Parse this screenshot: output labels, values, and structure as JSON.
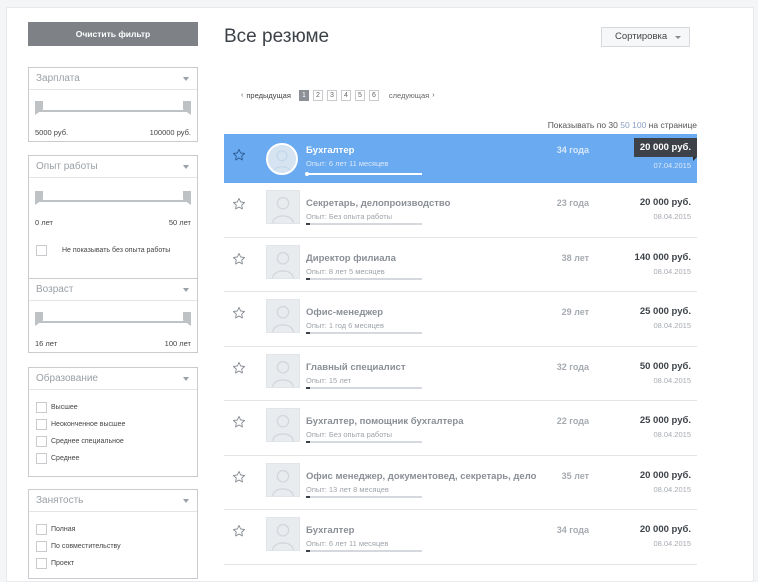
{
  "sidebar": {
    "clear_filter_label": "Очистить фильтр",
    "salary": {
      "title": "Зарплата",
      "min_label": "5000 руб.",
      "max_label": "100000 руб."
    },
    "experience": {
      "title": "Опыт работы",
      "min_label": "0 лет",
      "max_label": "50 лет",
      "no_exp_label": "Не показывать без опыта работы"
    },
    "age": {
      "title": "Возраст",
      "min_label": "16 лет",
      "max_label": "100 лет"
    },
    "education": {
      "title": "Образование",
      "items": [
        "Высшее",
        "Неоконченное высшее",
        "Среднее специальное",
        "Среднее"
      ]
    },
    "employment": {
      "title": "Занятость",
      "items": [
        "Полная",
        "По совместительству",
        "Проект"
      ]
    }
  },
  "main": {
    "title": "Все резюме",
    "sort_label": "Сортировка",
    "pager": {
      "prev": "предыдущая",
      "next": "следующая",
      "pages": [
        "1",
        "2",
        "3",
        "4",
        "5",
        "6"
      ],
      "active": "1"
    },
    "per_page": {
      "prefix": "Показывать по",
      "options": [
        "30",
        "50",
        "100"
      ],
      "suffix": "на странице"
    }
  },
  "resumes": [
    {
      "title": "Бухгалтер",
      "experience": "Опыт: 6 лет 11 месяцев",
      "age": "34 года",
      "salary": "20 000 руб.",
      "date": "07.04.2015"
    },
    {
      "title": "Секретарь, делопроизводство",
      "experience": "Опыт: Без опыта работы",
      "age": "23 года",
      "salary": "20 000 руб.",
      "date": "08.04.2015"
    },
    {
      "title": "Директор филиала",
      "experience": "Опыт: 8 лет 5 месяцев",
      "age": "38 лет",
      "salary": "140 000 руб.",
      "date": "08.04.2015"
    },
    {
      "title": "Офис-менеджер",
      "experience": "Опыт: 1 год 6 месяцев",
      "age": "29 лет",
      "salary": "25 000 руб.",
      "date": "08.04.2015"
    },
    {
      "title": "Главный специалист",
      "experience": "Опыт: 15 лет",
      "age": "32 года",
      "salary": "50 000 руб.",
      "date": "08.04.2015"
    },
    {
      "title": "Бухгалтер, помощник бухгалтера",
      "experience": "Опыт: Без опыта работы",
      "age": "22 года",
      "salary": "25 000 руб.",
      "date": "08.04.2015"
    },
    {
      "title": "Офис менеджер, документовед, секретарь, дело",
      "experience": "Опыт: 13 лет 8 месяцев",
      "age": "35 лет",
      "salary": "20 000 руб.",
      "date": "08.04.2015"
    },
    {
      "title": "Бухгалтер",
      "experience": "Опыт: 6 лет 11 месяцев",
      "age": "34 года",
      "salary": "20 000 руб.",
      "date": "08.04.2015"
    }
  ],
  "colors": {
    "selected_row": "#6aaaf0",
    "accent_dark": "#3d4248",
    "clear_button": "#7e8287"
  }
}
